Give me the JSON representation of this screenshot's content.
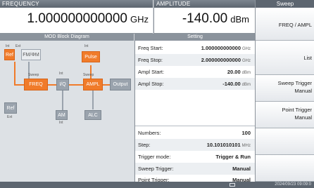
{
  "frequency": {
    "label": "FREQUENCY",
    "value": "1.000000000000",
    "unit": "GHz"
  },
  "amplitude": {
    "label": "AMPLITUDE",
    "value": "-140.00",
    "unit": "dBm"
  },
  "block_diagram": {
    "title": "MOD Block Diagram",
    "blocks": {
      "ref": "Ref",
      "fmpm": "FM/ΦM",
      "freq": "FREQ",
      "iq": "I/Q",
      "pulse": "Pulse",
      "ampl": "AMPL",
      "output": "Output",
      "ref2": "Ref",
      "am": "AM",
      "alc": "ALC"
    },
    "labels": {
      "int": "Int",
      "ext": "Ext",
      "sweep": "Sweep"
    }
  },
  "setting": {
    "title": "Setting",
    "rows": [
      {
        "key": "Freq Start:",
        "value": "1.000000000000",
        "unit": "GHz"
      },
      {
        "key": "Freq Stop:",
        "value": "2.000000000000",
        "unit": "GHz"
      },
      {
        "key": "Ampl Start:",
        "value": "20.00",
        "unit": "dBm"
      },
      {
        "key": "Ampl Stop:",
        "value": "-140.00",
        "unit": "dBm"
      },
      {
        "key": "Numbers:",
        "value": "100",
        "unit": ""
      },
      {
        "key": "Step:",
        "value": "10.101010101",
        "unit": "MHz"
      },
      {
        "key": "Trigger mode:",
        "value": "Trigger & Run",
        "unit": ""
      },
      {
        "key": "Sweep Trigger:",
        "value": "Manual",
        "unit": ""
      },
      {
        "key": "Point Trigger:",
        "value": "Manual",
        "unit": ""
      }
    ]
  },
  "softkeys": {
    "title": "Sweep",
    "items": [
      {
        "line1": "FREQ / AMPL",
        "line2": ""
      },
      {
        "line1": "List",
        "line2": ""
      },
      {
        "line1": "Sweep Trigger",
        "line2": "Manual"
      },
      {
        "line1": "Point Trigger",
        "line2": "Manual"
      },
      {
        "line1": "",
        "line2": ""
      },
      {
        "line1": "",
        "line2": ""
      }
    ]
  },
  "status": {
    "datetime": "2024/09/23 09:09:0"
  },
  "colors": {
    "accent": "#f07b2a",
    "header": "#5d6670"
  }
}
